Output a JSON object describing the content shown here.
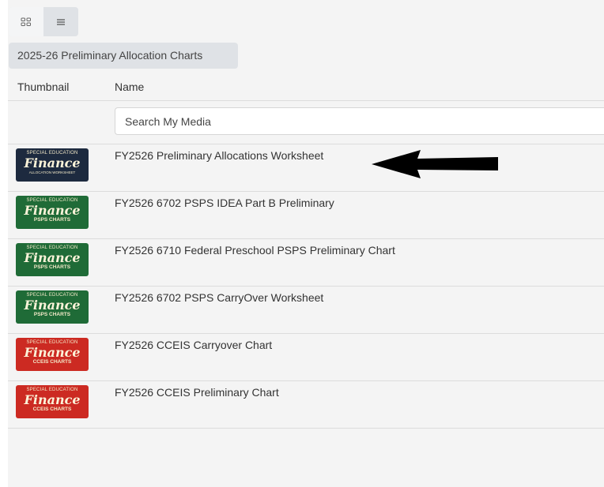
{
  "search": {
    "placeholder": "Search My Media"
  },
  "breadcrumb": {
    "label": "2025-26 Preliminary Allocation Charts"
  },
  "table": {
    "headers": {
      "thumbnail": "Thumbnail",
      "name": "Name"
    },
    "rows": [
      {
        "name": "FY2526 Preliminary Allocations Worksheet",
        "thumb": {
          "top": "SPECIAL EDUCATION",
          "mid": "Finance",
          "bottom": "ALLOCATION WORKSHEET",
          "color": "#1d2a3f"
        }
      },
      {
        "name": "FY2526 6702 PSPS IDEA Part B Preliminary",
        "thumb": {
          "top": "SPECIAL EDUCATION",
          "mid": "Finance",
          "bottom": "PSPS CHARTS",
          "color": "#1f6b37"
        }
      },
      {
        "name": "FY2526 6710 Federal Preschool PSPS Preliminary Chart",
        "thumb": {
          "top": "SPECIAL EDUCATION",
          "mid": "Finance",
          "bottom": "PSPS CHARTS",
          "color": "#1f6b37"
        }
      },
      {
        "name": "FY2526 6702 PSPS CarryOver Worksheet",
        "thumb": {
          "top": "SPECIAL EDUCATION",
          "mid": "Finance",
          "bottom": "PSPS CHARTS",
          "color": "#1f6b37"
        }
      },
      {
        "name": "FY2526 CCEIS Carryover Chart",
        "thumb": {
          "top": "SPECIAL EDUCATION",
          "mid": "Finance",
          "bottom": "CCEIS CHARTS",
          "color": "#cc2a22"
        }
      },
      {
        "name": "FY2526 CCEIS Preliminary Chart",
        "thumb": {
          "top": "SPECIAL EDUCATION",
          "mid": "Finance",
          "bottom": "CCEIS CHARTS",
          "color": "#cc2a22"
        }
      }
    ]
  }
}
